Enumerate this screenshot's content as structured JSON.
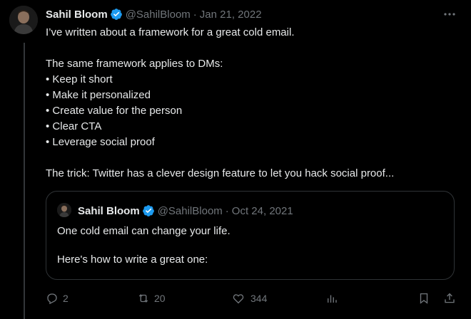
{
  "tweet": {
    "author_name": "Sahil Bloom",
    "handle": "@SahilBloom",
    "separator": "·",
    "date": "Jan 21, 2022",
    "lines": [
      "I’ve written about a framework for a great cold email.",
      "",
      "The same framework applies to DMs:",
      "• Keep it short",
      "• Make it personalized",
      "• Create value for the person",
      "• Clear CTA",
      "• Leverage social proof",
      "",
      "The trick: Twitter has a clever design feature to let you hack social proof..."
    ]
  },
  "quoted_tweet": {
    "author_name": "Sahil Bloom",
    "handle": "@SahilBloom",
    "separator": "·",
    "date": "Oct 24, 2021",
    "lines": [
      "One cold email can change your life.",
      "",
      "Here's how to write a great one:"
    ]
  },
  "actions": {
    "replies": "2",
    "retweets": "20",
    "likes": "344"
  },
  "colors": {
    "background": "#000000",
    "text": "#e7e9ea",
    "muted": "#71767b",
    "verified": "#1d9bf0",
    "border": "#2f3336"
  },
  "icons": [
    "more-icon",
    "verified-badge-icon",
    "reply-icon",
    "retweet-icon",
    "like-icon",
    "views-icon",
    "bookmark-icon",
    "share-icon"
  ]
}
